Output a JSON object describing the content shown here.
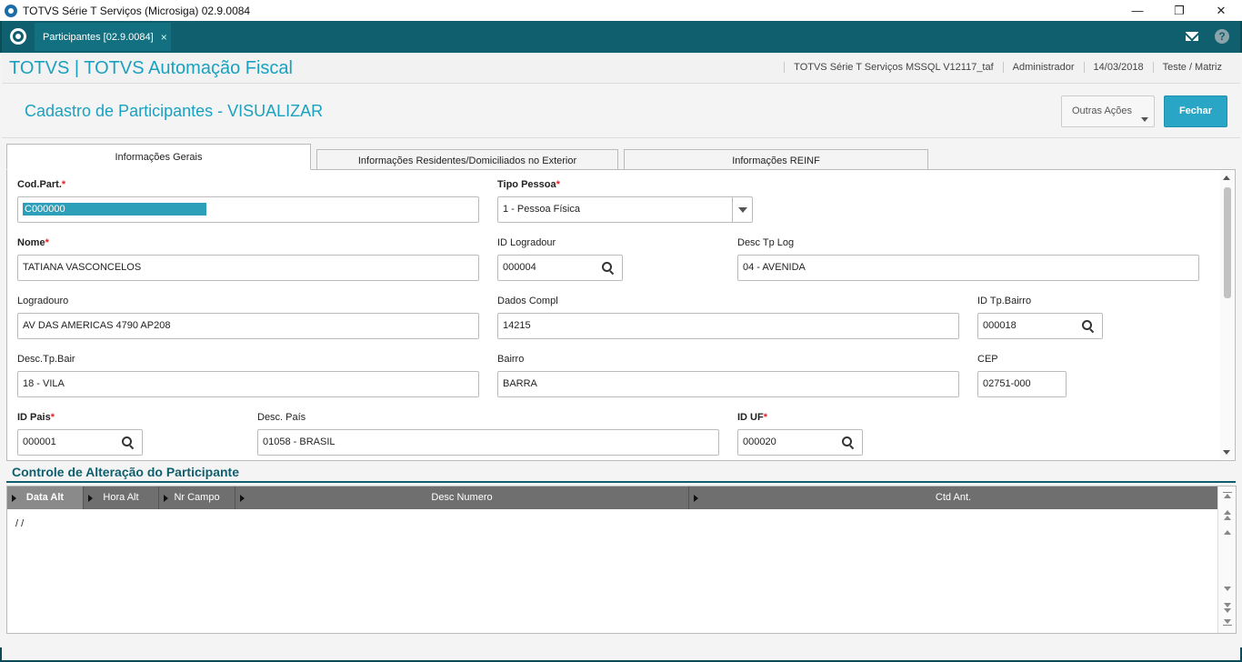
{
  "window": {
    "title": "TOTVS Série T Serviços (Microsiga) 02.9.0084",
    "minimize_glyph": "—",
    "restore_glyph": "❐",
    "close_glyph": "✕"
  },
  "tabstrip": {
    "active_tab": "Participantes [02.9.0084]",
    "close_glyph": "×",
    "help_glyph": "?"
  },
  "app_header": {
    "title": "TOTVS | TOTVS Automação Fiscal",
    "environment": "TOTVS Série T Serviços MSSQL V12117_taf",
    "user": "Administrador",
    "date": "14/03/2018",
    "branch": "Teste / Matriz"
  },
  "page": {
    "title": "Cadastro de Participantes - VISUALIZAR",
    "other_actions_label": "Outras Ações",
    "close_label": "Fechar"
  },
  "form_tabs": [
    {
      "label": "Informações Gerais",
      "active": true
    },
    {
      "label": "Informações Residentes/Domiciliados no Exterior",
      "active": false
    },
    {
      "label": "Informações REINF",
      "active": false
    }
  ],
  "required_marker": "*",
  "fields": {
    "cod_part": {
      "label": "Cod.Part.",
      "value": "C000000"
    },
    "tipo_pessoa": {
      "label": "Tipo Pessoa",
      "value": "1 - Pessoa Física"
    },
    "nome": {
      "label": "Nome",
      "value": "TATIANA VASCONCELOS"
    },
    "id_logradour": {
      "label": "ID Logradour",
      "value": "000004"
    },
    "desc_tp_log": {
      "label": "Desc Tp Log",
      "value": "04 - AVENIDA"
    },
    "logradouro": {
      "label": "Logradouro",
      "value": "AV DAS AMERICAS 4790 AP208"
    },
    "dados_compl": {
      "label": "Dados Compl",
      "value": "14215"
    },
    "id_tp_bairro": {
      "label": "ID Tp.Bairro",
      "value": "000018"
    },
    "desc_tp_bair": {
      "label": "Desc.Tp.Bair",
      "value": "18 - VILA"
    },
    "bairro": {
      "label": "Bairro",
      "value": "BARRA"
    },
    "cep": {
      "label": "CEP",
      "value": "02751-000"
    },
    "id_pais": {
      "label": "ID Pais",
      "value": "000001"
    },
    "desc_pais": {
      "label": "Desc. País",
      "value": "01058 - BRASIL"
    },
    "id_uf": {
      "label": "ID UF",
      "value": "000020"
    }
  },
  "control_section": {
    "title": "Controle de Alteração do Participante",
    "columns": [
      "Data Alt",
      "Hora Alt",
      "Nr Campo",
      "Desc Numero",
      "Ctd Ant."
    ],
    "rows": [
      {
        "data_alt": "/ /"
      }
    ]
  },
  "colors": {
    "brand_dark": "#0f5f6e",
    "accent": "#1aa1c0",
    "primary_button": "#29a6c5",
    "required": "#e0202a"
  }
}
